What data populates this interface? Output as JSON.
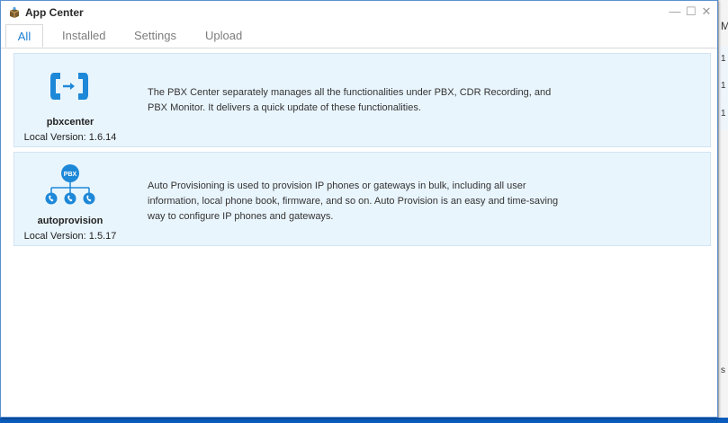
{
  "window": {
    "title": "App Center",
    "controls": {
      "minimize": "—",
      "maximize": "☐",
      "close": "✕"
    }
  },
  "tabs": [
    {
      "label": "All",
      "active": true
    },
    {
      "label": "Installed",
      "active": false
    },
    {
      "label": "Settings",
      "active": false
    },
    {
      "label": "Upload",
      "active": false
    }
  ],
  "apps": [
    {
      "name": "pbxcenter",
      "version": "Local Version: 1.6.14",
      "description": "The PBX Center separately manages all the functionalities under PBX, CDR Recording, and PBX Monitor. It delivers a quick update of these functionalities.",
      "icon": "pbx-center-phones-icon"
    },
    {
      "name": "autoprovision",
      "version": "Local Version: 1.5.17",
      "description": "Auto Provisioning is used to provision IP phones or gateways in bulk, including all user information, local phone book, firmware, and so on. Auto Provision is an easy and time-saving way to configure IP phones and gateways.",
      "icon": "auto-provision-tree-icon",
      "icon_label": "PBX"
    }
  ],
  "background_window": {
    "chars": [
      "M",
      "1",
      "1",
      "1",
      "s"
    ]
  },
  "colors": {
    "accent": "#1a7fd1",
    "card_bg": "#e9f5fd",
    "icon_blue": "#1e88d8",
    "desktop": "#0b63c8"
  }
}
